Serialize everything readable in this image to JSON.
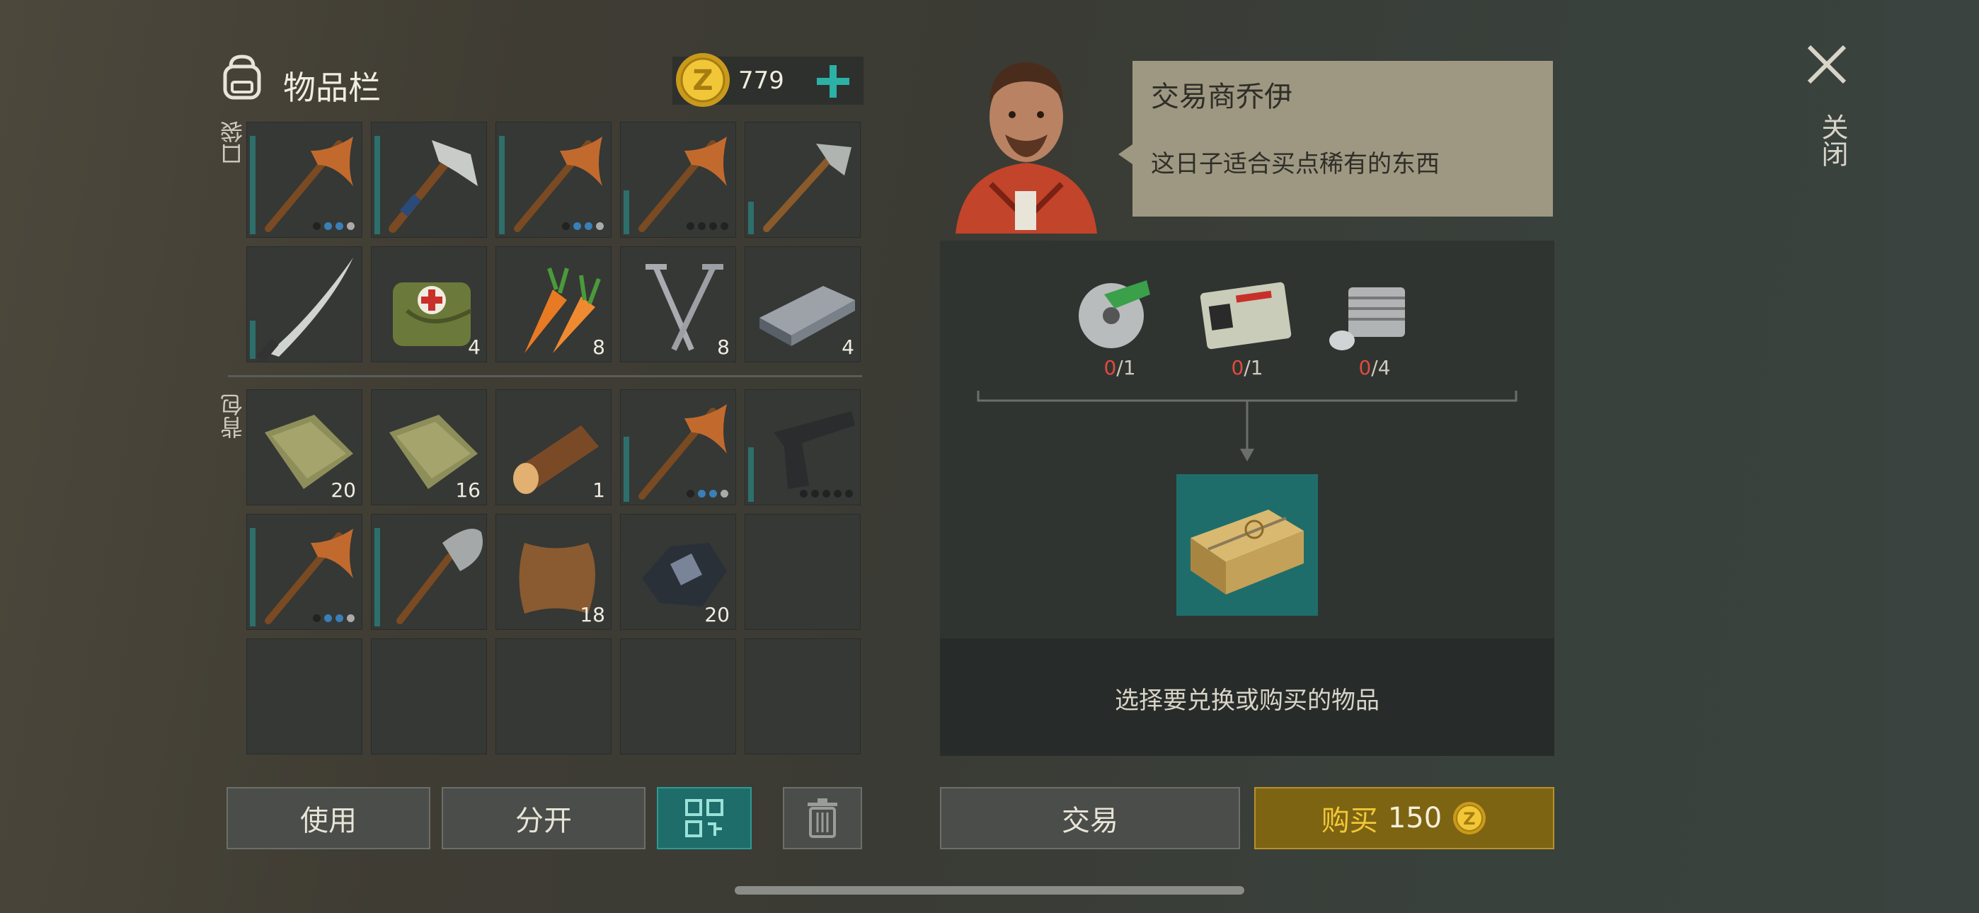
{
  "inventory": {
    "title": "物品栏",
    "coins": "779",
    "pocket_label": "口袋",
    "backpack_label": "背包",
    "pocket_slots": [
      {
        "icon": "pickaxe-icon",
        "bar": 0.9,
        "dots": [
          "#222",
          "#3a7fb8",
          "#3a7fb8",
          "#aaa"
        ]
      },
      {
        "icon": "hammer-icon",
        "bar": 0.9
      },
      {
        "icon": "pickaxe-icon",
        "bar": 0.9,
        "dots": [
          "#222",
          "#3a7fb8",
          "#3a7fb8",
          "#aaa"
        ]
      },
      {
        "icon": "pickaxe-icon",
        "bar": 0.4,
        "dots": [
          "#222",
          "#222",
          "#222",
          "#222"
        ]
      },
      {
        "icon": "small-pickaxe-icon",
        "bar": 0.3
      },
      {
        "icon": "machete-icon",
        "bar": 0.35
      },
      {
        "icon": "first-aid-bag-icon",
        "count": "4"
      },
      {
        "icon": "carrot-icon",
        "count": "8"
      },
      {
        "icon": "nails-icon",
        "count": "8"
      },
      {
        "icon": "iron-ingot-icon",
        "count": "4"
      }
    ],
    "backpack_slots": [
      {
        "icon": "cloth-icon",
        "count": "20"
      },
      {
        "icon": "cloth-icon",
        "count": "16"
      },
      {
        "icon": "log-icon",
        "count": "1"
      },
      {
        "icon": "pickaxe-icon",
        "bar": 0.6,
        "dots": [
          "#222",
          "#3a7fb8",
          "#3a7fb8",
          "#aaa"
        ]
      },
      {
        "icon": "pistol-icon",
        "bar": 0.5,
        "dots": [
          "#222",
          "#222",
          "#222",
          "#222",
          "#222"
        ]
      },
      {
        "icon": "pickaxe-icon",
        "bar": 0.9,
        "dots": [
          "#222",
          "#3a7fb8",
          "#3a7fb8",
          "#aaa"
        ]
      },
      {
        "icon": "shovel-icon",
        "bar": 0.9
      },
      {
        "icon": "leather-icon",
        "count": "18"
      },
      {
        "icon": "ore-icon",
        "count": "20"
      },
      {
        "icon": "",
        "count": ""
      },
      {
        "icon": "",
        "count": ""
      },
      {
        "icon": "",
        "count": ""
      },
      {
        "icon": "",
        "count": ""
      },
      {
        "icon": "",
        "count": ""
      },
      {
        "icon": "",
        "count": ""
      }
    ]
  },
  "buttons": {
    "use": "使用",
    "split": "分开",
    "trade": "交易",
    "buy_label": "购买",
    "buy_price": "150"
  },
  "trader": {
    "name": "交易商乔伊",
    "quote": "这日子适合买点稀有的东西",
    "requirements": [
      {
        "icon": "saw-blade-icon",
        "have": "0",
        "need": "/1"
      },
      {
        "icon": "army-id-card-icon",
        "have": "0",
        "need": "/1"
      },
      {
        "icon": "engine-cylinder-icon",
        "have": "0",
        "need": "/4"
      }
    ],
    "reward_icon": "weapon-crate-icon",
    "hint": "选择要兑换或购买的物品"
  },
  "close": {
    "label": "关闭"
  },
  "colors": {
    "accent_teal": "#1f6d6a",
    "buy_gold": "#7d6413",
    "buy_text": "#f2c737",
    "red": "#e04a3d"
  }
}
